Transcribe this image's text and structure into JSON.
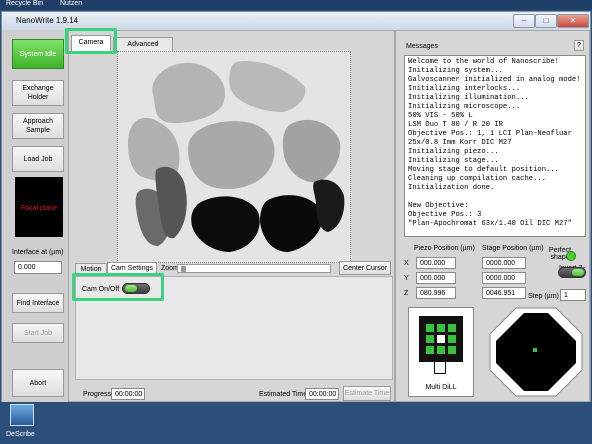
{
  "desktop": {
    "top_items": [
      "Recycle Bin",
      "Nutzen"
    ],
    "shortcut_label": "DeScribe"
  },
  "window": {
    "title": "NanoWrite 1.9.14",
    "help_label": "?"
  },
  "left_panel": {
    "status_button": "System Idle",
    "exchange_holder": "Exchange Holder",
    "approach_sample": "Approach Sample",
    "load_job": "Load Job",
    "focal_plane_label": "Focal plane",
    "interface_label": "Interface at (µm)",
    "interface_value": "0.000",
    "find_interface": "Find Interface",
    "start_job": "Start Job",
    "abort": "Abort"
  },
  "tabs": [
    "Camera",
    "Advanced Settings"
  ],
  "sub_tabs": [
    "Motion",
    "Cam Settings"
  ],
  "zoom_label": "Zoom",
  "center_cursor": "Center Cursor",
  "cam_onoff_label": "Cam On/Off",
  "progress_label": "Progress",
  "progress_value": "00:00:00",
  "estimated_label": "Estimated Time",
  "estimated_value": "00:00:00",
  "estimate_button": "Estimate Time",
  "messages": {
    "title": "Messages",
    "lines": [
      "Welcome to the world of Nanoscribe!",
      "Initializing system...",
      "Galvoscanner initialized in analog mode!",
      "Initializing interlocks...",
      "Initializing illumination...",
      "Initializing microscope...",
      "50% VIS - 50% L",
      "LSM Duo T 80 / R 20 IR",
      "Objective Pos.: 1, 1 LCI Plan-Neofluar",
      "25x/0.8 Imm Korr DIC M27",
      "Initializing piezo...",
      "Initializing stage...",
      "Moving stage to default position...",
      "Cleaning up compilation cache...",
      "Initialization done.",
      "",
      "New Objective:",
      "Objective Pos.: 3",
      "\"Plan-Apochromat 63x/1.40 Oil DIC M27\""
    ]
  },
  "position": {
    "piezo_header": "Piezo Position (µm)",
    "stage_header": "Stage Position (µm)",
    "axes": [
      "X",
      "Y",
      "Z"
    ],
    "piezo": [
      "000.000",
      "000.000",
      "080.996"
    ],
    "stage": [
      "0000.000",
      "0000.000",
      "0046.951"
    ],
    "perfect_shape": "Perfect shape",
    "invert_z": "Invert Z-Axis",
    "step_label": "Step (µm)",
    "step_value": "1"
  },
  "multi_dill_label": "Multi DiLL",
  "colors": {
    "status_green": "#3fb22a",
    "highlight_green": "#3ad27e",
    "indicator_green": "#4bd12f"
  }
}
